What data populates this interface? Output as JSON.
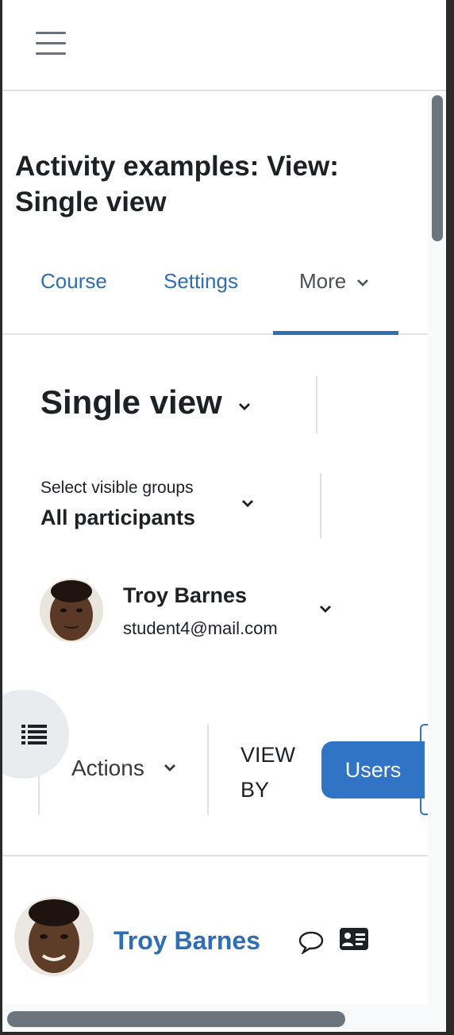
{
  "header": {
    "menu_icon": "hamburger-menu-icon"
  },
  "page": {
    "title": "Activity examples: View: Single view"
  },
  "tabs": [
    {
      "label": "Course"
    },
    {
      "label": "Settings"
    },
    {
      "label": "More"
    }
  ],
  "report_selector": {
    "label": "Single view"
  },
  "groups": {
    "label": "Select visible groups",
    "value": "All participants"
  },
  "user_selector": {
    "name": "Troy Barnes",
    "email": "student4@mail.com"
  },
  "toolbar": {
    "actions_label": "Actions",
    "view_by_line1": "VIEW",
    "view_by_line2": "BY",
    "users_button": "Users"
  },
  "row": {
    "name": "Troy Barnes",
    "message_icon": "message-icon",
    "profile_icon": "contact-card-icon"
  },
  "drawer": {
    "icon": "list-icon"
  },
  "colors": {
    "link": "#2f6db5",
    "primary": "#3173c4",
    "text": "#1d2125",
    "border": "#dee2e6"
  }
}
